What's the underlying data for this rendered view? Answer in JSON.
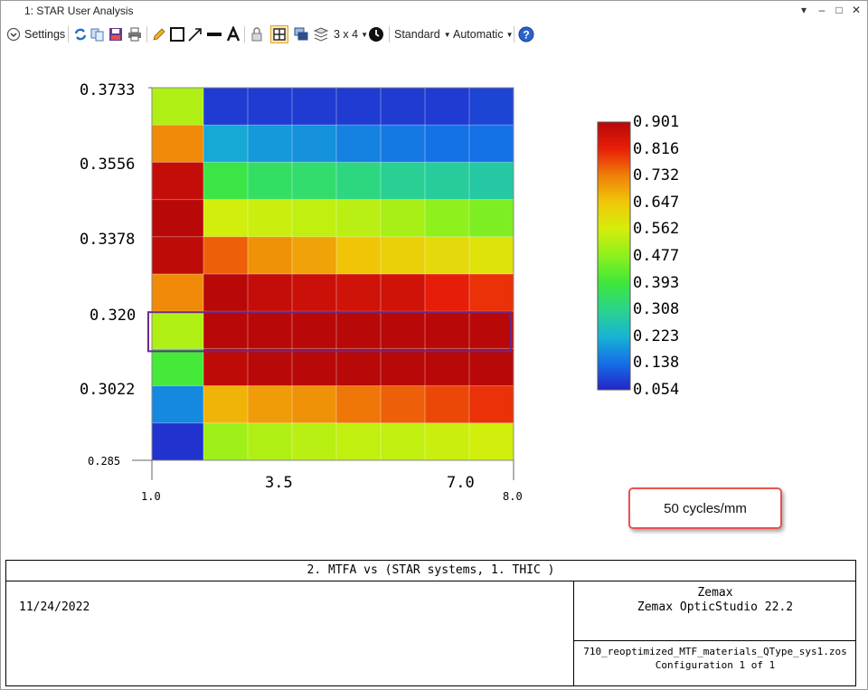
{
  "window": {
    "title": "1: STAR User Analysis",
    "controls": [
      "▾",
      "–",
      "□",
      "✕"
    ]
  },
  "toolbar": {
    "settings_label": "Settings",
    "grid_label": "3 x 4",
    "standard_label": "Standard",
    "automatic_label": "Automatic",
    "icons": [
      "refresh-icon",
      "copy-icon",
      "save-icon",
      "print-icon",
      "pencil-icon",
      "rectangle-icon",
      "arrow-icon",
      "line-icon",
      "text-icon",
      "lock-icon",
      "layout-icon",
      "windows-icon",
      "layers-icon",
      "grid-icon",
      "clock-icon",
      "help-icon"
    ]
  },
  "chart_data": {
    "type": "heatmap",
    "x_range": [
      1.0,
      8.0
    ],
    "y_range": [
      0.285,
      0.3733
    ],
    "x_ticks": [
      "1.0",
      "3.5",
      "7.0",
      "8.0"
    ],
    "y_ticks": [
      "0.3733",
      "0.3556",
      "0.3378",
      "0.320",
      "0.3022",
      "0.285"
    ],
    "rows": 10,
    "cols": 8,
    "grid": true,
    "colorbar": {
      "min": 0.054,
      "max": 0.901,
      "labels": [
        "0.901",
        "0.816",
        "0.732",
        "0.647",
        "0.562",
        "0.477",
        "0.393",
        "0.308",
        "0.223",
        "0.138",
        "0.054"
      ],
      "colors": [
        "#2424c8",
        "#1470e6",
        "#18b4d2",
        "#2ad48c",
        "#3ee83a",
        "#8cf01c",
        "#d4ee0c",
        "#f0c808",
        "#f08008",
        "#e81e08",
        "#b80808"
      ]
    },
    "highlight_row": 6,
    "highlight_color": "#6a2a8a",
    "values": [
      [
        0.52,
        0.08,
        0.08,
        0.08,
        0.08,
        0.08,
        0.08,
        0.09
      ],
      [
        0.72,
        0.21,
        0.19,
        0.18,
        0.16,
        0.15,
        0.14,
        0.14
      ],
      [
        0.88,
        0.38,
        0.35,
        0.34,
        0.32,
        0.3,
        0.29,
        0.28
      ],
      [
        0.93,
        0.56,
        0.55,
        0.54,
        0.53,
        0.51,
        0.48,
        0.46
      ],
      [
        0.89,
        0.76,
        0.71,
        0.69,
        0.65,
        0.63,
        0.61,
        0.59
      ],
      [
        0.72,
        0.91,
        0.88,
        0.87,
        0.86,
        0.86,
        0.82,
        0.8
      ],
      [
        0.52,
        0.97,
        0.96,
        0.96,
        0.95,
        0.95,
        0.94,
        0.93
      ],
      [
        0.4,
        0.89,
        0.9,
        0.91,
        0.91,
        0.91,
        0.91,
        0.92
      ],
      [
        0.17,
        0.67,
        0.7,
        0.71,
        0.74,
        0.76,
        0.78,
        0.8
      ],
      [
        0.07,
        0.5,
        0.52,
        0.53,
        0.54,
        0.54,
        0.55,
        0.56
      ]
    ]
  },
  "badge": {
    "label": "50 cycles/mm"
  },
  "footer": {
    "title": "2. MTFA vs (STAR systems, 1. THIC )",
    "date": "11/24/2022",
    "company": "Zemax",
    "product": "Zemax OpticStudio 22.2",
    "file": "710_reoptimized_MTF_materials_QType_sys1.zos",
    "config": "Configuration 1 of 1"
  }
}
